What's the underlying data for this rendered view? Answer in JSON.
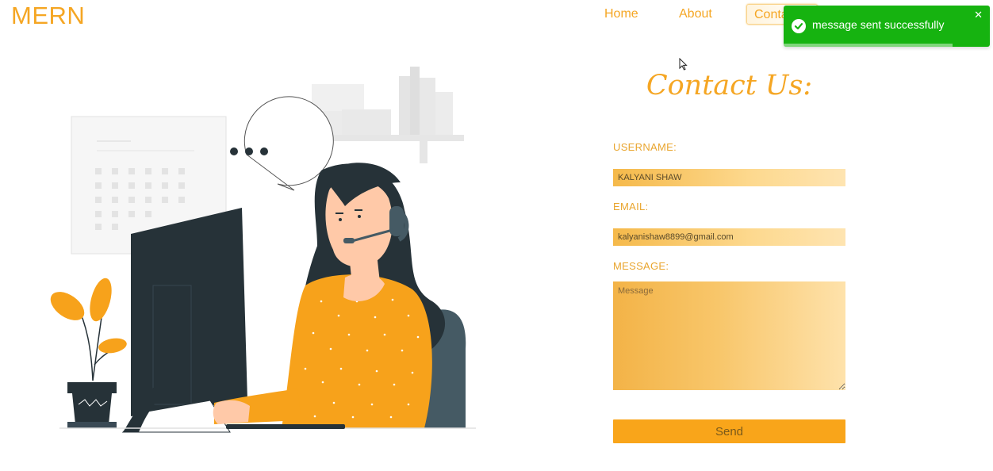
{
  "header": {
    "logo": "MERN",
    "nav": {
      "home": "Home",
      "about": "About",
      "contact": "Contact"
    }
  },
  "toast": {
    "message": "message sent successfully",
    "close_symbol": "✕",
    "icon": "check-circle-icon",
    "progress_fraction": 0.82
  },
  "contact": {
    "title": "Contact Us:",
    "username_label": "USERNAME:",
    "username_value": "KALYANI SHAW",
    "email_label": "EMAIL:",
    "email_value": "kalyanishaw8899@gmail.com",
    "message_label": "MESSAGE:",
    "message_placeholder": "Message",
    "send_label": "Send"
  },
  "colors": {
    "accent": "#f5a623",
    "toast_bg": "#16b310",
    "button_bg": "#f9a51a"
  }
}
